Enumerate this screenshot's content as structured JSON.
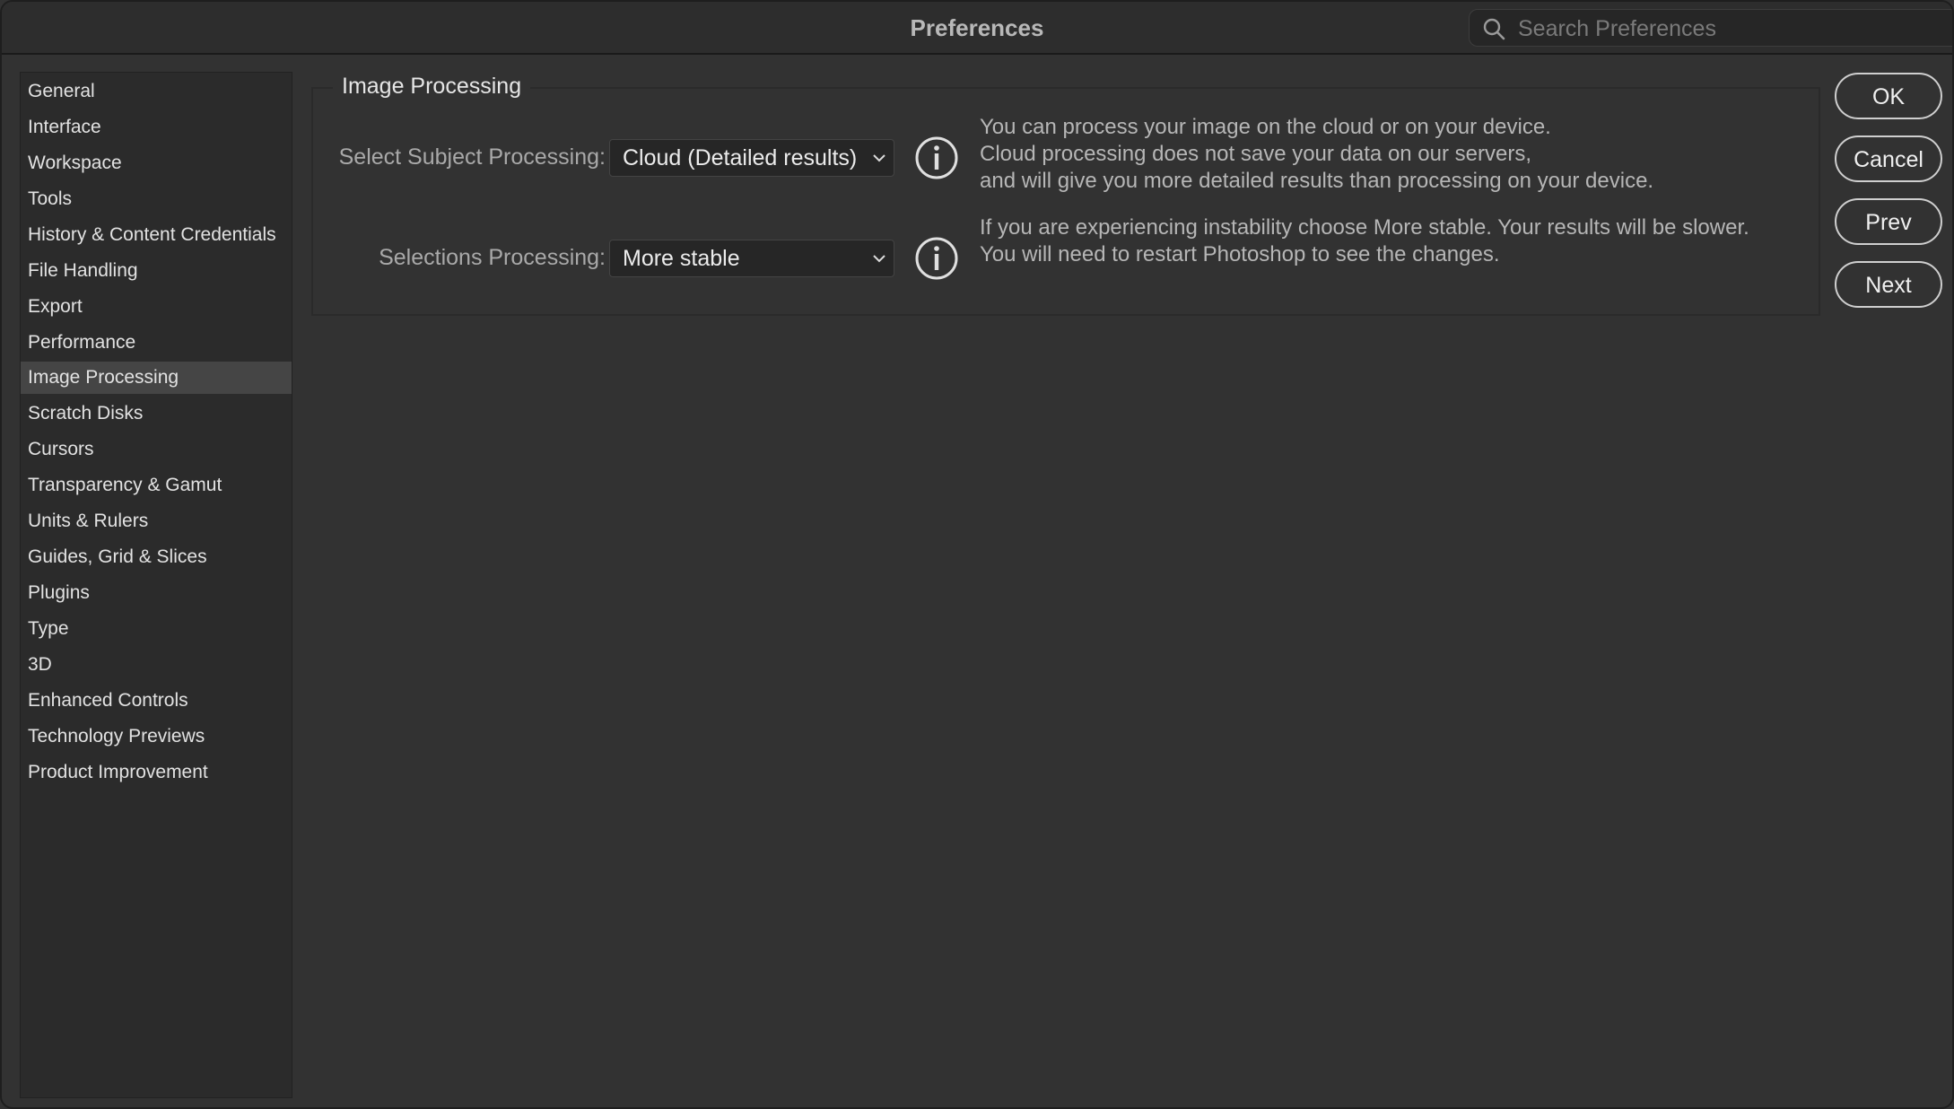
{
  "window": {
    "title": "Preferences"
  },
  "search": {
    "placeholder": "Search Preferences"
  },
  "sidebar": {
    "items": [
      {
        "label": "General"
      },
      {
        "label": "Interface"
      },
      {
        "label": "Workspace"
      },
      {
        "label": "Tools"
      },
      {
        "label": "History & Content Credentials"
      },
      {
        "label": "File Handling"
      },
      {
        "label": "Export"
      },
      {
        "label": "Performance"
      },
      {
        "label": "Image Processing",
        "selected": true
      },
      {
        "label": "Scratch Disks"
      },
      {
        "label": "Cursors"
      },
      {
        "label": "Transparency & Gamut"
      },
      {
        "label": "Units & Rulers"
      },
      {
        "label": "Guides, Grid & Slices"
      },
      {
        "label": "Plugins"
      },
      {
        "label": "Type"
      },
      {
        "label": "3D"
      },
      {
        "label": "Enhanced Controls"
      },
      {
        "label": "Technology Previews"
      },
      {
        "label": "Product Improvement"
      }
    ]
  },
  "panel": {
    "title": "Image Processing",
    "select_subject": {
      "label": "Select Subject Processing:",
      "value": "Cloud (Detailed results)",
      "info": [
        "You can process your image on the cloud or on your device.",
        "Cloud processing does not save your data on our servers,",
        "and will give you more detailed results than processing on your device."
      ]
    },
    "selections": {
      "label": "Selections Processing:",
      "value": "More stable",
      "info": [
        "If you are experiencing instability choose More stable. Your results will be slower.",
        "You will need to restart Photoshop to see the changes."
      ]
    }
  },
  "buttons": {
    "ok": "OK",
    "cancel": "Cancel",
    "prev": "Prev",
    "next": "Next"
  },
  "icons": {
    "search": "search-icon",
    "info": "info-icon",
    "dropdown": "chevron-down-icon"
  },
  "colors": {
    "background": "#323232",
    "selected_item": "#454545",
    "button_border": "#cfcfcf"
  }
}
